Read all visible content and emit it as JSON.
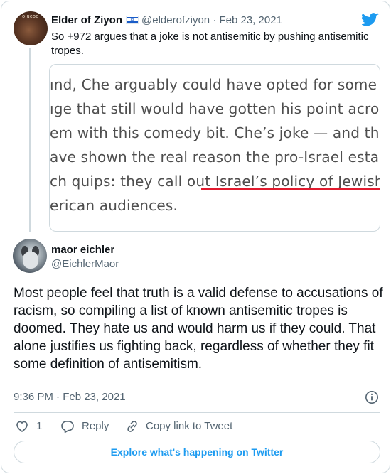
{
  "parent_tweet": {
    "avatar_text": "oiucoo",
    "name": "Elder of Ziyon",
    "flag_icon": "israel-flag-icon",
    "handle": "@elderofziyon",
    "separator": "·",
    "date": "Feb 23, 2021",
    "text": "So +972 argues that a joke is not antisemitic by pushing antisemitic tropes.",
    "brand_icon": "twitter-bird-icon",
    "brand_color": "#1d9bf0"
  },
  "quoted_image": {
    "lines": [
      "ınd, Che arguably could have opted for some mo",
      "ıge that still would have gotten his point across. E",
      "em with this comedy bit. Che’s joke — and the ba",
      "ave shown the real reason the pro-Israel establish",
      "ch quips: they call out ",
      "erican audiences."
    ],
    "highlight_text": "Israel’s policy of Jewish sup",
    "underline_color": "#e21b2f"
  },
  "main_tweet": {
    "name": "maor eichler",
    "handle": "@EichlerMaor",
    "text": "Most people feel that truth is a valid defense to accusations of racism, so compiling a list of known antisemitic tropes is doomed. They hate us and would harm us if they could. That alone justifies us fighting back, regardless of whether they fit some definition of antisemitism.",
    "timestamp": "9:36 PM · Feb 23, 2021",
    "info_icon": "info-icon"
  },
  "actions": {
    "like_count": "1",
    "reply_label": "Reply",
    "copy_link_label": "Copy link to Tweet"
  },
  "explore_label": "Explore what's happening on Twitter",
  "colors": {
    "text_primary": "#0f1419",
    "text_secondary": "#536471",
    "border": "#cfd9de",
    "accent": "#1d9bf0"
  }
}
